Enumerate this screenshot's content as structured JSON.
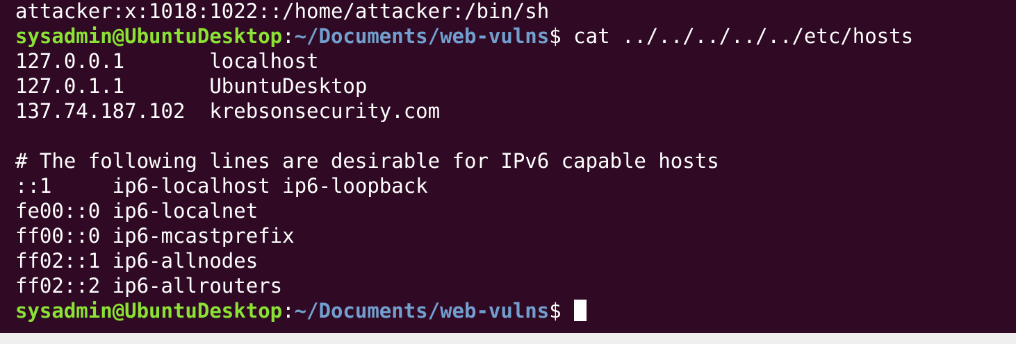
{
  "terminal": {
    "prompt": {
      "user_host": "sysadmin@UbuntuDesktop",
      "colon": ":",
      "path": "~/Documents/web-vulns",
      "symbol": "$"
    },
    "command": "cat ../../../../../etc/hosts",
    "previous_output_line": "attacker:x:1018:1022::/home/attacker:/bin/sh",
    "hosts_output": [
      "127.0.0.1       localhost",
      "127.0.1.1       UbuntuDesktop",
      "137.74.187.102  krebsonsecurity.com",
      "",
      "# The following lines are desirable for IPv6 capable hosts",
      "::1     ip6-localhost ip6-loopback",
      "fe00::0 ip6-localnet",
      "ff00::0 ip6-mcastprefix",
      "ff02::1 ip6-allnodes",
      "ff02::2 ip6-allrouters"
    ]
  },
  "colors": {
    "background": "#300a24",
    "prompt_user": "#8ae234",
    "prompt_path": "#729fcf",
    "text": "#ffffff"
  }
}
